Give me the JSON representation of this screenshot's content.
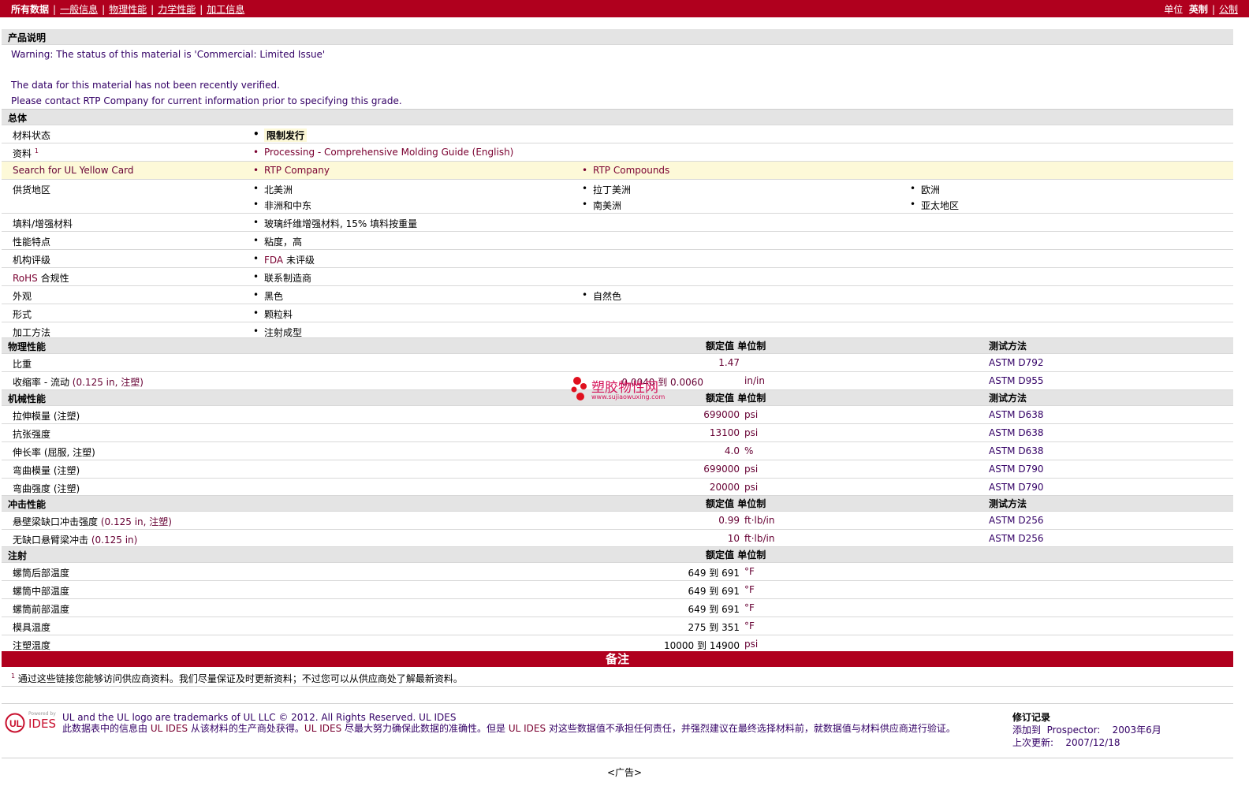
{
  "nav": {
    "all_data": "所有数据",
    "general": "一般信息",
    "physical": "物理性能",
    "mechanical": "力学性能",
    "processing": "加工信息",
    "units_label": "单位",
    "english": "英制",
    "metric": "公制"
  },
  "product_desc": {
    "title": "产品说明",
    "line1": "Warning: The status of this material is 'Commercial: Limited Issue'",
    "line2": "The data for this material has not been recently verified.",
    "line3": "Please contact RTP Company for current information prior to specifying this grade."
  },
  "general": {
    "title": "总体",
    "status_label": "材料状态",
    "status_value": "限制发行",
    "docs_label": "资料",
    "docs_sup": "1",
    "docs_value": "Processing - Comprehensive Molding Guide (English)",
    "ul_label": "Search for UL Yellow Card",
    "ul_v1": "RTP Company",
    "ul_v2": "RTP Compounds",
    "region_label": "供货地区",
    "regions": [
      "北美洲",
      "拉丁美洲",
      "欧洲",
      "非洲和中东",
      "南美洲",
      "亚太地区"
    ],
    "filler_label": "填料/增强材料",
    "filler_value": "玻璃纤维增强材料, 15% 填料按重量",
    "feature_label": "性能特点",
    "feature_value": "粘度，高",
    "agency_label": "机构评级",
    "agency_fda": "FDA",
    "agency_value": " 未评级",
    "rohs_link": "RoHS",
    "rohs_label": " 合规性",
    "rohs_value": "联系制造商",
    "appearance_label": "外观",
    "appearance_v1": "黑色",
    "appearance_v2": "自然色",
    "form_label": "形式",
    "form_value": "颗粒料",
    "method_label": "加工方法",
    "method_value": "注射成型"
  },
  "headers": {
    "nominal": "额定值",
    "unit": "单位制",
    "test": "测试方法"
  },
  "physical": {
    "title": "物理性能",
    "rows": [
      {
        "label": "比重",
        "cond": "",
        "value": "1.47",
        "unit": "",
        "test": "ASTM D792"
      },
      {
        "label": "收缩率 - 流动",
        "cond": "(0.125 in, 注塑)",
        "value": "0.0040 到  0.0060",
        "unit": "in/in",
        "test": "ASTM D955"
      }
    ]
  },
  "mechanical": {
    "title": "机械性能",
    "rows": [
      {
        "label": "拉伸模量",
        "cond": "(注塑)",
        "value": "699000",
        "unit": "psi",
        "test": "ASTM D638"
      },
      {
        "label": "抗张强度",
        "cond": "",
        "value": "13100",
        "unit": "psi",
        "test": "ASTM D638"
      },
      {
        "label": "伸长率",
        "cond": "(屈服, 注塑)",
        "value": "4.0",
        "unit": "%",
        "test": "ASTM D638"
      },
      {
        "label": "弯曲模量",
        "cond": "(注塑)",
        "value": "699000",
        "unit": "psi",
        "test": "ASTM D790"
      },
      {
        "label": "弯曲强度",
        "cond": "(注塑)",
        "value": "20000",
        "unit": "psi",
        "test": "ASTM D790"
      }
    ]
  },
  "impact": {
    "title": "冲击性能",
    "rows": [
      {
        "label": "悬壁梁缺口冲击强度",
        "cond": "(0.125 in, 注塑)",
        "value": "0.99",
        "unit": "ft·lb/in",
        "test": "ASTM D256"
      },
      {
        "label": "无缺口悬臂梁冲击",
        "cond": "(0.125 in)",
        "value": "10",
        "unit": "ft·lb/in",
        "test": "ASTM D256"
      }
    ]
  },
  "injection": {
    "title": "注射",
    "rows": [
      {
        "label": "螺筒后部温度",
        "value": "649 到  691",
        "unit": "°F"
      },
      {
        "label": "螺筒中部温度",
        "value": "649 到  691",
        "unit": "°F"
      },
      {
        "label": "螺筒前部温度",
        "value": "649 到  691",
        "unit": "°F"
      },
      {
        "label": "模具温度",
        "value": "275 到  351",
        "unit": "°F"
      },
      {
        "label": "注塑温度",
        "value": "10000 到  14900",
        "unit": "psi"
      }
    ]
  },
  "notes": {
    "title": "备注",
    "sup": "1",
    "text": "通过这些链接您能够访问供应商资料。我们尽量保证及时更新资料；不过您可以从供应商处了解最新资料。"
  },
  "footer": {
    "logo_small": "Powered by",
    "logo_text": "IDES",
    "line1": "UL and the UL logo are trademarks of UL LLC © 2012. All Rights Reserved. UL IDES",
    "line2_a": "此数据表中的信息由 ",
    "line2_ul1": "UL IDES",
    "line2_b": " 从该材料的生产商处获得。",
    "line2_ul2": "UL IDES",
    "line2_c": " 尽最大努力确保此数据的准确性。但是 ",
    "line2_ul3": "UL IDES",
    "line2_d": " 对这些数据值不承担任何责任，并强烈建议在最终选择材料前，就数据值与材料供应商进行验证。",
    "rev_title": "修订记录",
    "rev_added": "添加到",
    "rev_prospector": "Prospector:",
    "rev_added_date": "2003年6月",
    "rev_updated": "上次更新:",
    "rev_updated_date": "2007/12/18"
  },
  "watermark": {
    "cn": "塑胶物性网",
    "url": "www.sujiaowuxing.com"
  },
  "ad": "<广告>",
  "colors": {
    "brand_red": "#b0001e",
    "section_gray": "#e4e4e4",
    "highlight_yellow": "#fdf9d8",
    "text_purple": "#330066"
  }
}
